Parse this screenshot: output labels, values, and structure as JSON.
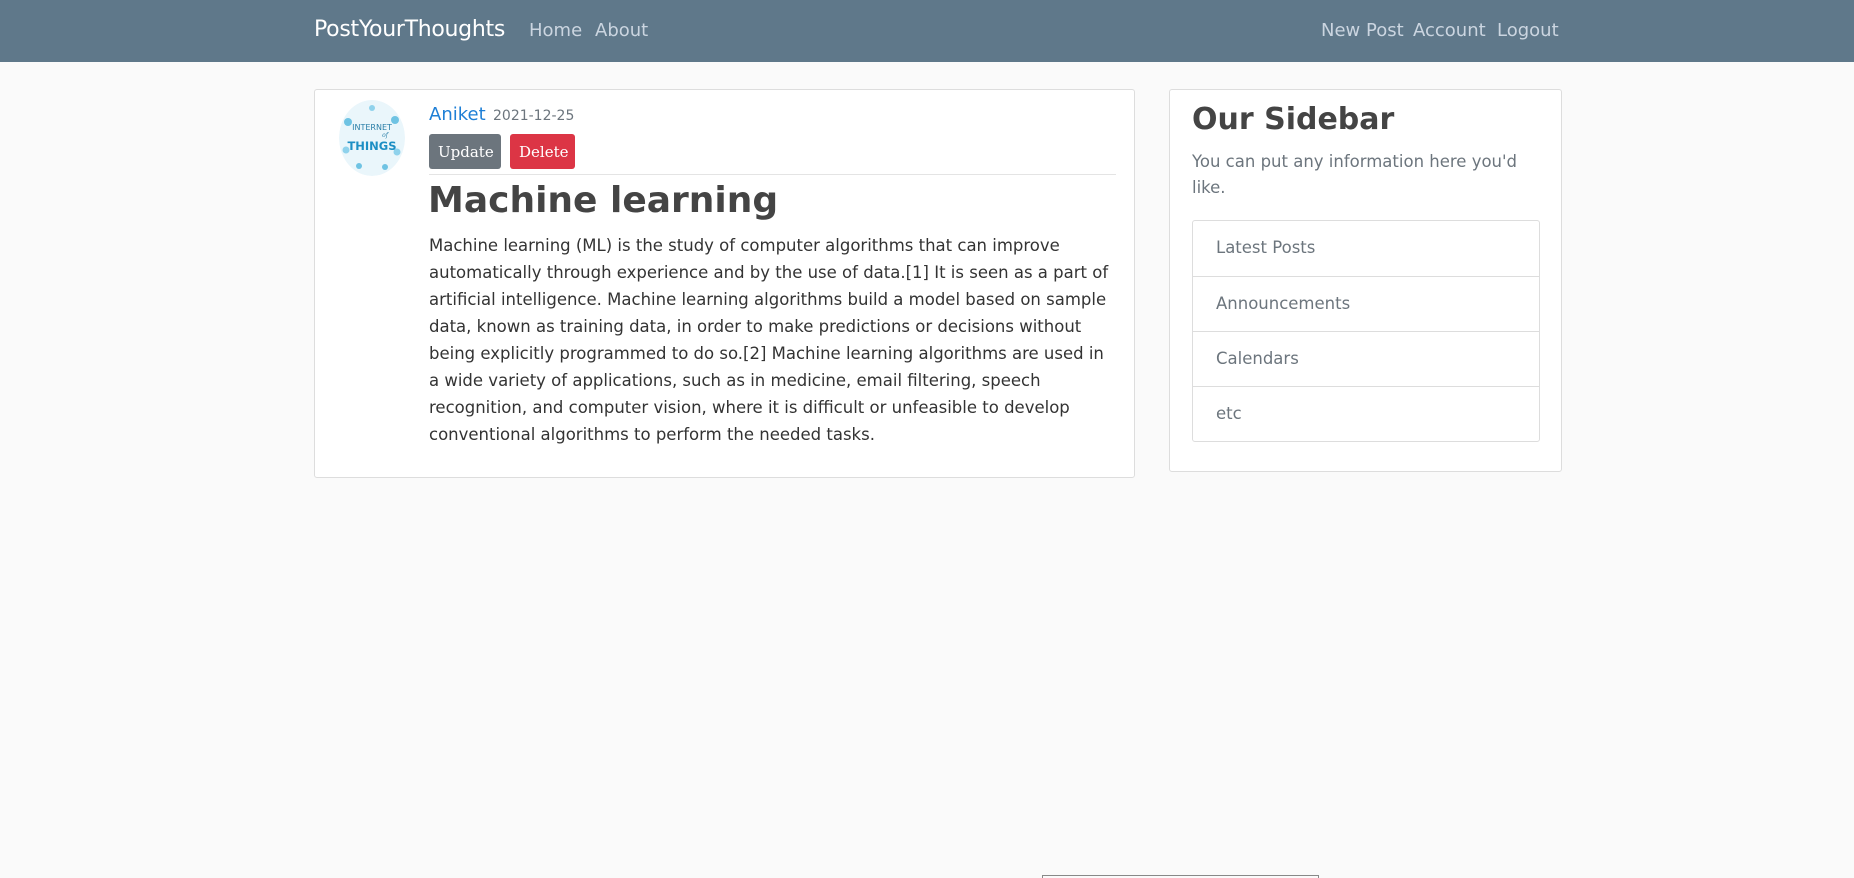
{
  "navbar": {
    "brand": "PostYourThoughts",
    "left_links": [
      "Home",
      "About"
    ],
    "right_links": [
      "New Post",
      "Account",
      "Logout"
    ]
  },
  "post": {
    "author": "Aniket",
    "date": "2021-12-25",
    "update_label": "Update",
    "delete_label": "Delete",
    "title": "Machine learning",
    "content": "Machine learning (ML) is the study of computer algorithms that can improve automatically through experience and by the use of data.[1] It is seen as a part of artificial intelligence. Machine learning algorithms build a model based on sample data, known as training data, in order to make predictions or decisions without being explicitly programmed to do so.[2] Machine learning algorithms are used in a wide variety of applications, such as in medicine, email filtering, speech recognition, and computer vision, where it is difficult or unfeasible to develop conventional algorithms to perform the needed tasks.",
    "avatar_text": [
      "INTERNET",
      "of",
      "THINGS"
    ]
  },
  "sidebar": {
    "title": "Our Sidebar",
    "description": "You can put any information here you'd like.",
    "items": [
      "Latest Posts",
      "Announcements",
      "Calendars",
      "etc"
    ]
  },
  "colors": {
    "navbar": "#5f788a",
    "link": "#1e7fd6",
    "update_button": "#6c757d",
    "delete_button": "#dc3545",
    "background": "#fafafa"
  }
}
